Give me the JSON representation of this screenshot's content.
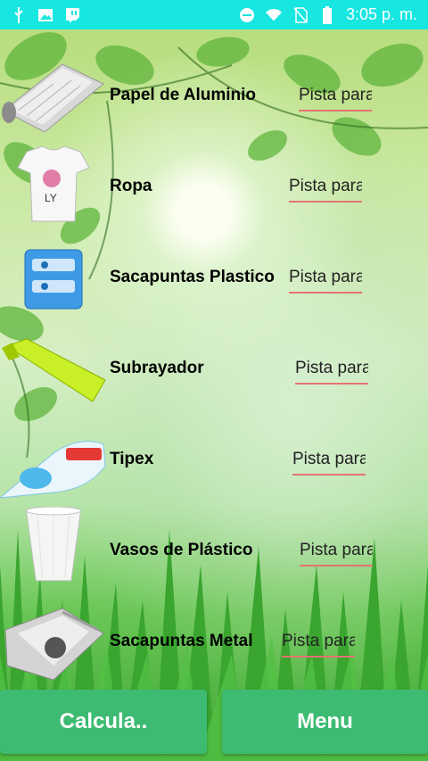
{
  "status_bar": {
    "time": "3:05 p. m.",
    "icons": [
      "usb-icon",
      "image-icon",
      "twitch-icon",
      "dnd-icon",
      "wifi-icon",
      "no-sim-icon",
      "battery-icon"
    ]
  },
  "items": [
    {
      "label": "Papel de Aluminio",
      "placeholder": "Pista para",
      "icon": "aluminum-foil-icon"
    },
    {
      "label": "Ropa",
      "placeholder": "Pista para",
      "icon": "tshirt-icon"
    },
    {
      "label": "Sacapuntas Plastico",
      "placeholder": "Pista para",
      "icon": "plastic-sharpener-icon"
    },
    {
      "label": "Subrayador",
      "placeholder": "Pista para",
      "icon": "highlighter-icon"
    },
    {
      "label": "Tipex",
      "placeholder": "Pista para",
      "icon": "correction-tape-icon"
    },
    {
      "label": "Vasos de Plástico",
      "placeholder": "Pista para",
      "icon": "plastic-cup-icon"
    },
    {
      "label": "Sacapuntas  Metal",
      "placeholder": "Pista para",
      "icon": "metal-sharpener-icon"
    }
  ],
  "buttons": {
    "calculate": "Calcula..",
    "menu": "Menu"
  },
  "colors": {
    "status_bar": "#17e6e1",
    "button": "#3dbb72",
    "hint_underline": "#e57373"
  }
}
